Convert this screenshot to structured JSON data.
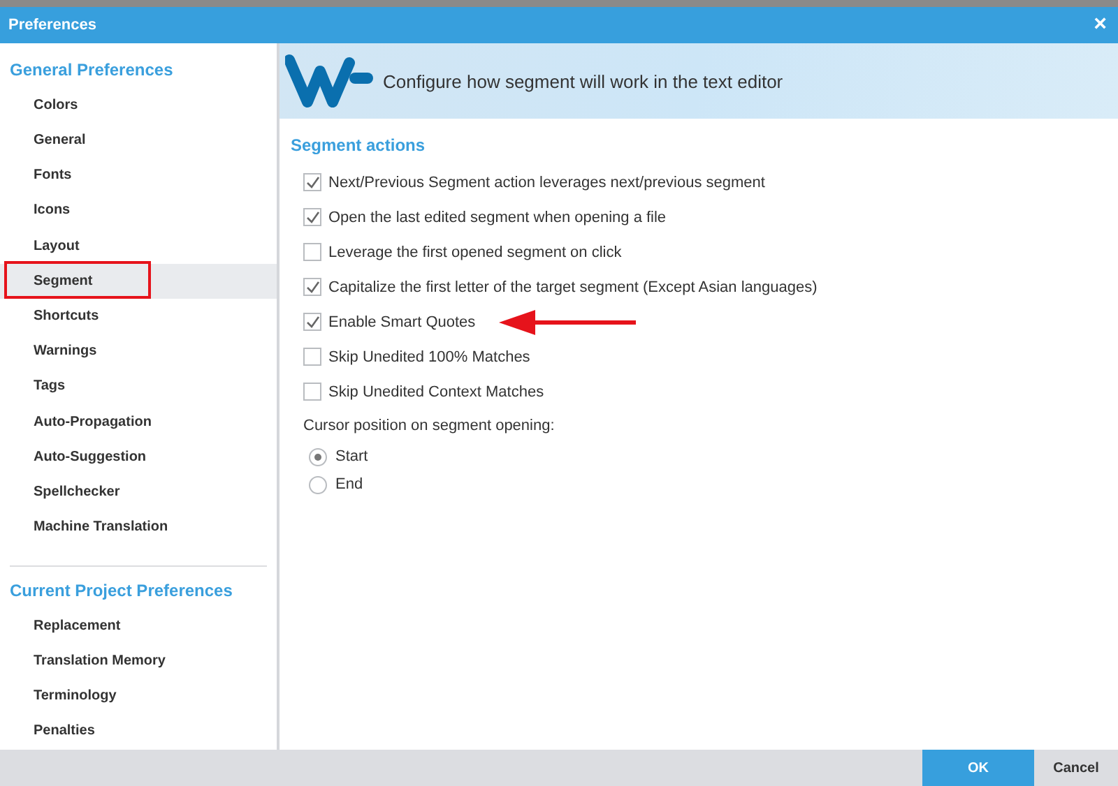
{
  "window": {
    "title": "Preferences",
    "close": "×"
  },
  "sidebar": {
    "sections": [
      {
        "title": "General Preferences",
        "items": [
          {
            "label": "Colors",
            "selected": false,
            "highlighted": false
          },
          {
            "label": "General",
            "selected": false,
            "highlighted": false
          },
          {
            "label": "Fonts",
            "selected": false,
            "highlighted": false
          },
          {
            "label": "Icons",
            "selected": false,
            "highlighted": false
          },
          {
            "label": "Layout",
            "selected": false,
            "highlighted": false
          },
          {
            "label": "Segment",
            "selected": true,
            "highlighted": true
          },
          {
            "label": "Shortcuts",
            "selected": false,
            "highlighted": false
          },
          {
            "label": "Warnings",
            "selected": false,
            "highlighted": false
          },
          {
            "label": "Tags",
            "selected": false,
            "highlighted": false
          },
          {
            "label": "Auto-Propagation",
            "selected": false,
            "highlighted": false
          },
          {
            "label": "Auto-Suggestion",
            "selected": false,
            "highlighted": false
          },
          {
            "label": "Spellchecker",
            "selected": false,
            "highlighted": false
          },
          {
            "label": "Machine Translation",
            "selected": false,
            "highlighted": false
          }
        ]
      },
      {
        "title": "Current Project Preferences",
        "items": [
          {
            "label": "Replacement",
            "selected": false,
            "highlighted": false
          },
          {
            "label": "Translation Memory",
            "selected": false,
            "highlighted": false
          },
          {
            "label": "Terminology",
            "selected": false,
            "highlighted": false
          },
          {
            "label": "Penalties",
            "selected": false,
            "highlighted": false
          }
        ]
      }
    ]
  },
  "banner": {
    "text": "Configure how segment will work in the text editor"
  },
  "content": {
    "heading": "Segment actions",
    "options": [
      {
        "label": "Next/Previous Segment action leverages next/previous segment",
        "checked": true,
        "annotated": false
      },
      {
        "label": "Open the last edited segment when opening a file",
        "checked": true,
        "annotated": false
      },
      {
        "label": "Leverage the first opened segment on click",
        "checked": false,
        "annotated": false
      },
      {
        "label": "Capitalize the first letter of the target segment (Except Asian languages)",
        "checked": true,
        "annotated": false
      },
      {
        "label": "Enable Smart Quotes",
        "checked": true,
        "annotated": true
      },
      {
        "label": "Skip Unedited 100% Matches",
        "checked": false,
        "annotated": false
      },
      {
        "label": "Skip Unedited Context Matches",
        "checked": false,
        "annotated": false
      }
    ],
    "cursor_label": "Cursor position on segment opening:",
    "cursor_options": [
      {
        "label": "Start",
        "selected": true
      },
      {
        "label": "End",
        "selected": false
      }
    ]
  },
  "footer": {
    "buttons": [
      {
        "label": "OK",
        "kind": "primary"
      },
      {
        "label": "Cancel",
        "kind": "secondary"
      }
    ]
  }
}
